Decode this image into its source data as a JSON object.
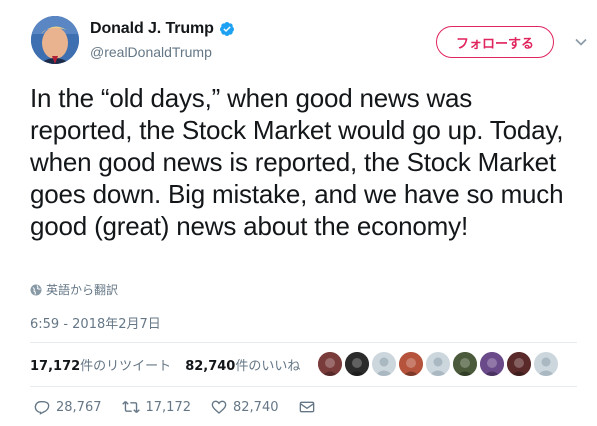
{
  "user": {
    "display_name": "Donald J. Trump",
    "handle": "@realDonaldTrump",
    "verified": true
  },
  "follow_button": {
    "label": "フォローする",
    "color": "#e0245e"
  },
  "tweet": {
    "text": "In the “old days,” when good news was reported, the Stock Market would go up. Today, when good news is reported, the Stock Market goes down. Big mistake, and we have so much good (great) news about the economy!",
    "translate_label": "英語から翻訳",
    "timestamp": "6:59 - 2018年2月7日"
  },
  "stats": {
    "retweets_count": "17,172",
    "retweets_label": "件のリツイート",
    "likes_count": "82,740",
    "likes_label": "件のいいね"
  },
  "likers": [
    {
      "icon": "avatar-1",
      "color": "#7a3b3b"
    },
    {
      "icon": "avatar-2",
      "color": "#2b2b2b"
    },
    {
      "icon": "avatar-3",
      "color": "#ccd6dd"
    },
    {
      "icon": "avatar-4",
      "color": "#b5533c"
    },
    {
      "icon": "avatar-5",
      "color": "#ccd6dd"
    },
    {
      "icon": "avatar-6",
      "color": "#4a5a3a"
    },
    {
      "icon": "avatar-7",
      "color": "#6b4a8a"
    },
    {
      "icon": "avatar-8",
      "color": "#5a2a2a"
    },
    {
      "icon": "avatar-9",
      "color": "#ccd6dd"
    }
  ],
  "actions": {
    "replies": "28,767",
    "retweets": "17,172",
    "likes": "82,740"
  },
  "colors": {
    "text_primary": "#14171a",
    "text_secondary": "#657786",
    "verified_blue": "#1da1f2",
    "divider": "#e6ecf0"
  }
}
